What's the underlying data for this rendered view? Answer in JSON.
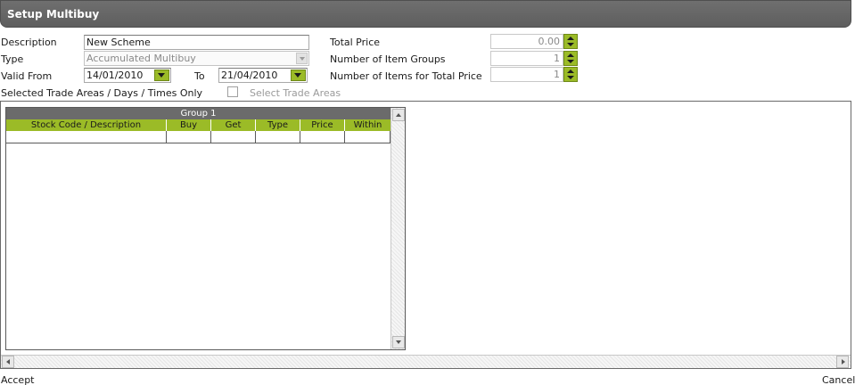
{
  "window": {
    "title": "Setup Multibuy"
  },
  "form": {
    "description": {
      "label": "Description",
      "value": "New Scheme"
    },
    "type": {
      "label": "Type",
      "value": "Accumulated Multibuy"
    },
    "valid_from": {
      "label": "Valid From",
      "value": "14/01/2010"
    },
    "to": {
      "label": "To",
      "value": "21/04/2010"
    },
    "selected_trade_areas_only": {
      "label": "Selected Trade Areas / Days / Times Only",
      "checked": false
    },
    "select_trade_areas": {
      "label": "Select Trade Areas"
    },
    "total_price": {
      "label": "Total Price",
      "value": "0.00"
    },
    "number_of_item_groups": {
      "label": "Number of Item Groups",
      "value": "1"
    },
    "number_of_items_for_total_price": {
      "label": "Number of Items for Total Price",
      "value": "1"
    }
  },
  "grid": {
    "group_title": "Group 1",
    "columns": [
      "Stock Code / Description",
      "Buy",
      "Get",
      "Type",
      "Price",
      "Within"
    ],
    "rows": [
      [
        "",
        "",
        "",
        "",
        "",
        ""
      ]
    ]
  },
  "footer": {
    "accept_label": "Accept",
    "cancel_label": "Cancel"
  },
  "colors": {
    "accent_green": "#9bbb27",
    "title_bar": "#666666",
    "group_header": "#6b6b6b"
  },
  "icons": {
    "dropdown": "chevron-down-icon",
    "spinner": "spinner-icon",
    "scroll": "scroll-arrow-icon"
  }
}
